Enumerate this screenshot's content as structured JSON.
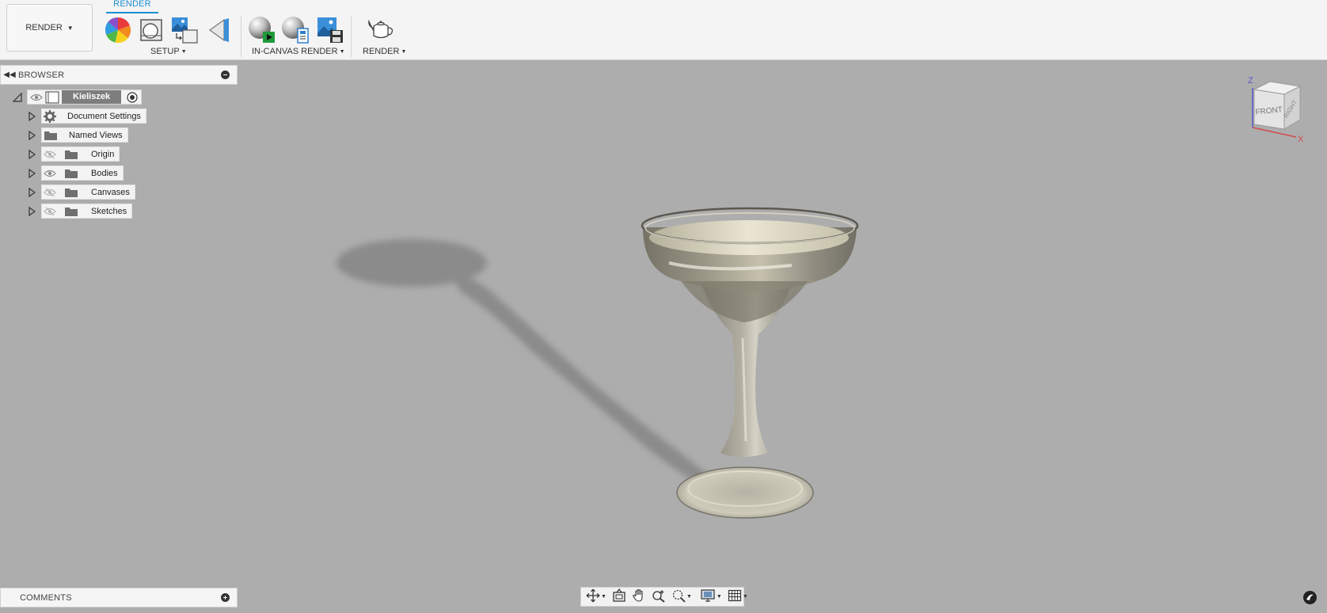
{
  "toolbar": {
    "workspace_label": "RENDER",
    "active_tab": "RENDER",
    "groups": {
      "setup": "SETUP",
      "in_canvas_render": "IN-CANVAS RENDER",
      "render": "RENDER"
    },
    "tools": [
      "appearance-icon",
      "scene-settings-icon",
      "texture-map-icon",
      "decal-icon",
      "in-canvas-render-icon",
      "in-canvas-settings-icon",
      "capture-image-icon",
      "render-teapot-icon"
    ]
  },
  "browser": {
    "title": "BROWSER",
    "root": {
      "label": "Kieliszek"
    },
    "items": [
      {
        "label": "Document Settings",
        "icon": "gear-icon",
        "eye": "none"
      },
      {
        "label": "Named Views",
        "icon": "folder-icon",
        "eye": "none"
      },
      {
        "label": "Origin",
        "icon": "folder-icon",
        "eye": "hidden"
      },
      {
        "label": "Bodies",
        "icon": "folder-icon",
        "eye": "visible"
      },
      {
        "label": "Canvases",
        "icon": "folder-icon",
        "eye": "hidden"
      },
      {
        "label": "Sketches",
        "icon": "folder-icon",
        "eye": "hidden"
      }
    ]
  },
  "viewcube": {
    "front_label": "FRONT",
    "right_label": "RIGHT",
    "axis_z": "Z",
    "axis_x": "X"
  },
  "comments": {
    "title": "COMMENTS"
  },
  "navbar": {
    "tools": [
      "orbit-icon",
      "look-at-icon",
      "pan-icon",
      "zoom-icon",
      "fit-icon",
      "display-settings-icon",
      "grid-icon"
    ]
  },
  "colors": {
    "accent": "#1a8fd0",
    "viewport_background": "#adadad",
    "panel_background": "#f5f5f5"
  }
}
